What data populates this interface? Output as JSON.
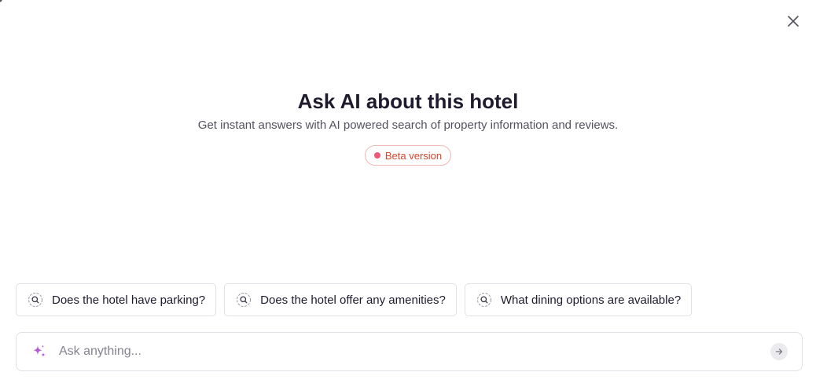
{
  "dialog": {
    "title": "Ask AI about this hotel",
    "subtitle": "Get instant answers with AI powered search of property information and reviews.",
    "badge": {
      "label": "Beta version",
      "dot_color": "#ee5a7b",
      "text_color": "#d9452c"
    },
    "close_icon": "close-icon"
  },
  "suggestions": [
    {
      "label": "Does the hotel have parking?",
      "icon": "search-sparkle-icon"
    },
    {
      "label": "Does the hotel offer any amenities?",
      "icon": "search-sparkle-icon"
    },
    {
      "label": "What dining options are available?",
      "icon": "search-sparkle-icon"
    }
  ],
  "ask_bar": {
    "placeholder": "Ask anything...",
    "value": "",
    "leading_icon": "sparkle-icon",
    "send_icon": "arrow-right-icon"
  },
  "colors": {
    "title": "#1f1a2e",
    "subtitle": "#55505f",
    "border": "#e2e0e6",
    "sparkle_gradient": [
      "#e14fb7",
      "#8b5cf6"
    ]
  }
}
